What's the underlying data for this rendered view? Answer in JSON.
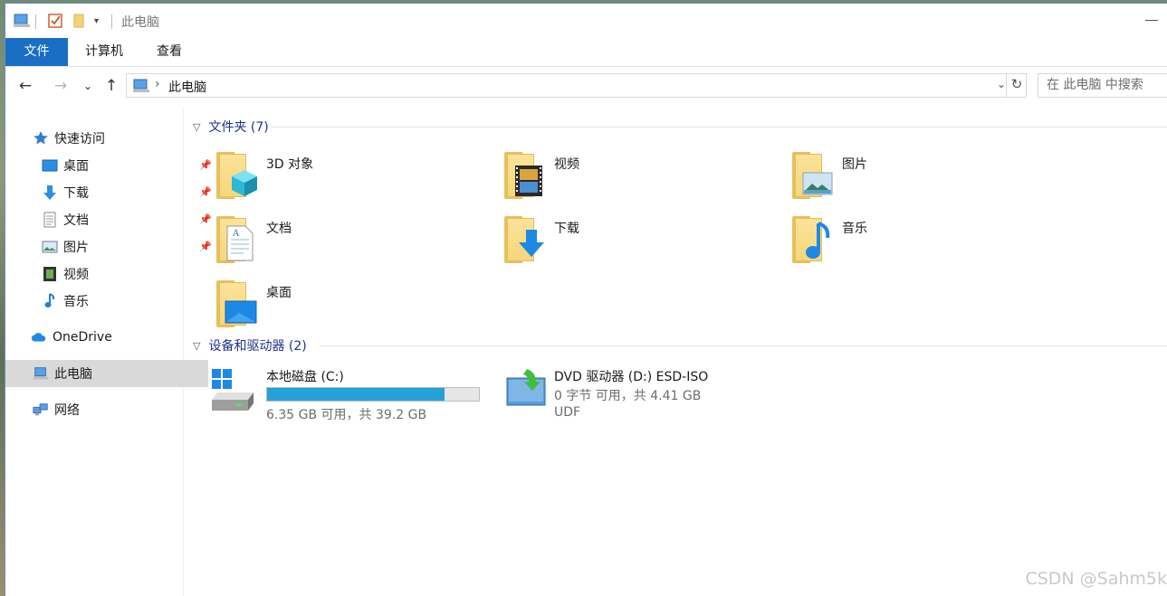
{
  "window": {
    "title": "此电脑"
  },
  "ribbon": {
    "tabs": [
      {
        "label": "文件"
      },
      {
        "label": "计算机"
      },
      {
        "label": "查看"
      }
    ]
  },
  "address": {
    "crumb": "此电脑",
    "search_placeholder": "在 此电脑 中搜索"
  },
  "nav": {
    "quick_access": "快速访问",
    "items": [
      {
        "label": "桌面",
        "pinned": true
      },
      {
        "label": "下载",
        "pinned": true
      },
      {
        "label": "文档",
        "pinned": true
      },
      {
        "label": "图片",
        "pinned": true
      },
      {
        "label": "视频",
        "pinned": false
      },
      {
        "label": "音乐",
        "pinned": false
      }
    ],
    "onedrive": "OneDrive",
    "this_pc": "此电脑",
    "network": "网络"
  },
  "content": {
    "folders_header": "文件夹 (7)",
    "folders": [
      {
        "label": "3D 对象"
      },
      {
        "label": "视频"
      },
      {
        "label": "图片"
      },
      {
        "label": "文档"
      },
      {
        "label": "下载"
      },
      {
        "label": "音乐"
      },
      {
        "label": "桌面"
      }
    ],
    "devices_header": "设备和驱动器 (2)",
    "drives": [
      {
        "label": "本地磁盘 (C:)",
        "free_text": "6.35 GB 可用，共 39.2 GB",
        "used_fraction": 0.838
      },
      {
        "label": "DVD 驱动器 (D:) ESD-ISO",
        "free_text": "0 字节 可用，共 4.41 GB",
        "fs": "UDF"
      }
    ]
  },
  "watermark": "CSDN @Sahm5k",
  "colors": {
    "accent": "#1a6fc4",
    "link": "#1e3287",
    "progress": "#26a0da"
  }
}
